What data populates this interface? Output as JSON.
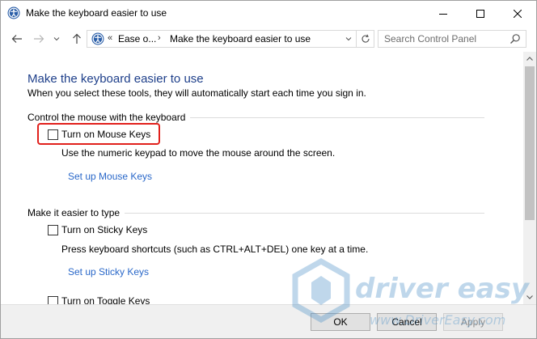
{
  "window": {
    "title": "Make the keyboard easier to use"
  },
  "address_bar": {
    "chevron_prefix": "«",
    "crumb_parent": "Ease o...",
    "crumb_separator": "›",
    "crumb_current": "Make the keyboard easier to use"
  },
  "search": {
    "placeholder": "Search Control Panel"
  },
  "content": {
    "title": "Make the keyboard easier to use",
    "subtitle": "When you select these tools, they will automatically start each time you sign in."
  },
  "sections": [
    {
      "heading": "Control the mouse with the keyboard",
      "option_label": "Turn on Mouse Keys",
      "option_checked": false,
      "description": "Use the numeric keypad to move the mouse around the screen.",
      "link": "Set up Mouse Keys"
    },
    {
      "heading": "Make it easier to type",
      "option_label": "Turn on Sticky Keys",
      "option_checked": false,
      "description": "Press keyboard shortcuts (such as CTRL+ALT+DEL) one key at a time.",
      "link": "Set up Sticky Keys"
    },
    {
      "option_label": "Turn on Toggle Keys",
      "option_checked": false
    }
  ],
  "footer": {
    "ok": "OK",
    "cancel": "Cancel",
    "apply": "Apply"
  },
  "watermark": {
    "brand": "driver easy",
    "url": "www.DriverEasy.com"
  },
  "colors": {
    "title_blue": "#1e3f8a",
    "link_blue": "#2a68c9",
    "highlight_red": "#e1201c"
  }
}
